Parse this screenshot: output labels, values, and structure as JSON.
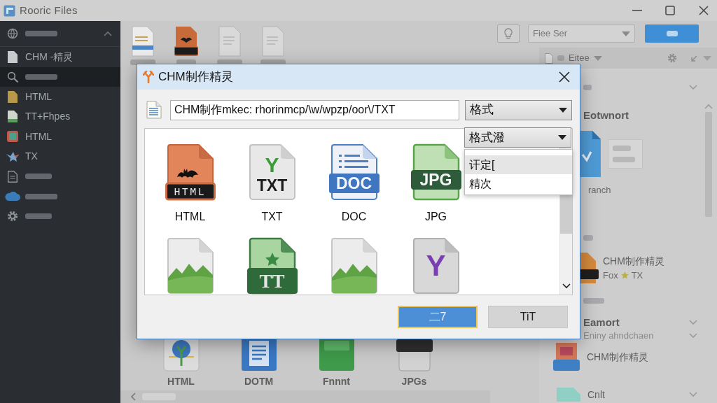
{
  "app": {
    "title": "Rooric Files",
    "sidebar": [
      {
        "kind": "globe",
        "expanded": true,
        "selected": false
      },
      {
        "kind": "file",
        "label": "CHM -精灵",
        "selected": false
      },
      {
        "kind": "search",
        "selected": true
      },
      {
        "kind": "folder",
        "label": "HTML",
        "selected": false
      },
      {
        "kind": "sheet",
        "label": "TT+Fhpes",
        "selected": false
      },
      {
        "kind": "image",
        "label": "HTML",
        "selected": false
      },
      {
        "kind": "bird",
        "label": "TX",
        "selected": false
      },
      {
        "kind": "doc",
        "selected": false
      },
      {
        "kind": "cloud",
        "selected": false
      },
      {
        "kind": "gear",
        "selected": false
      }
    ],
    "toolbar": [
      {
        "kind": "doc"
      },
      {
        "kind": "html"
      },
      {
        "kind": "blank"
      },
      {
        "kind": "blank"
      }
    ],
    "filter": {
      "value": "Fiee Ser"
    },
    "panel": {
      "tab": "Eitee",
      "heading": "Eotwnort",
      "caption": "ranch",
      "entry": {
        "title": "CHM制作精灵",
        "subtitle": "Fox",
        "tag": "TX"
      },
      "section": "Eamort",
      "section_note": "Eniny ahndchaen",
      "section_entry": "CHM制作精灵",
      "last_entry": "Cnlt"
    },
    "bottom_files": [
      {
        "kind": "tree",
        "label": "HTML"
      },
      {
        "kind": "doc",
        "label": "DOTM"
      },
      {
        "kind": "green",
        "label": "Fnnnt"
      },
      {
        "kind": "jpg",
        "label": "JPGs"
      }
    ]
  },
  "dialog": {
    "title": "CHM制作精灵",
    "path": {
      "value": "CHM制作mkec: rhorinmcp/\\w/wpzp/oor\\/TXT"
    },
    "format": {
      "value": "格式"
    },
    "format_filter": {
      "value": "格式潑",
      "expanded": true,
      "options": [
        {
          "label": "讦定[",
          "selected": true
        },
        {
          "label": "精次",
          "selected": false
        }
      ]
    },
    "files": [
      {
        "kind": "html",
        "badge": "HTML",
        "label": "HTML"
      },
      {
        "kind": "txt",
        "logo": "Y",
        "badge": "TXT",
        "label": "TXT"
      },
      {
        "kind": "doc",
        "badge": "DOC",
        "label": "DOC"
      },
      {
        "kind": "jpg",
        "badge": "JPG",
        "label": "JPG"
      },
      {
        "kind": "image"
      },
      {
        "kind": "tt",
        "badge": "TT"
      },
      {
        "kind": "image"
      },
      {
        "kind": "letter",
        "logo": "Y"
      }
    ],
    "buttons": [
      {
        "label": "二7",
        "kind": "primary"
      },
      {
        "label": "TiT",
        "kind": "secondary"
      }
    ]
  }
}
